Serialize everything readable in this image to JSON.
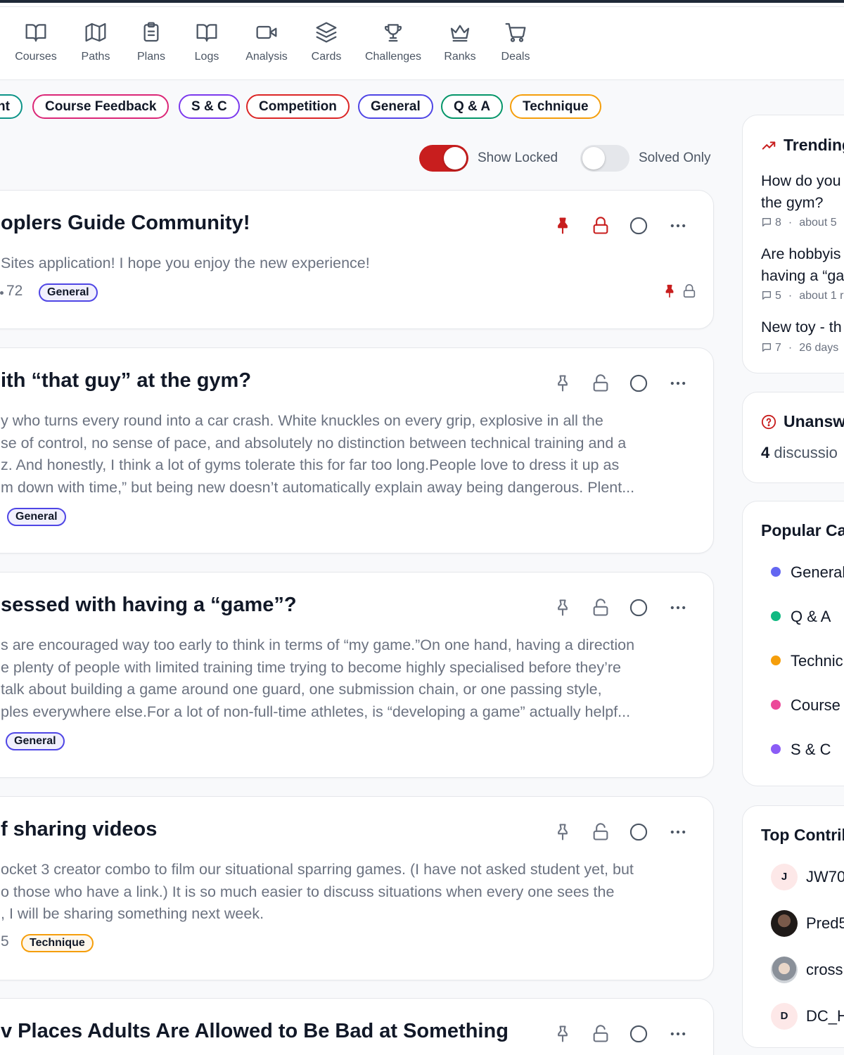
{
  "nav": {
    "items": [
      {
        "label": "Courses",
        "icon": "book-open-icon"
      },
      {
        "label": "Paths",
        "icon": "map-icon"
      },
      {
        "label": "Plans",
        "icon": "clipboard-icon"
      },
      {
        "label": "Logs",
        "icon": "book-icon"
      },
      {
        "label": "Analysis",
        "icon": "video-icon"
      },
      {
        "label": "Cards",
        "icon": "layers-icon"
      },
      {
        "label": "Challenges",
        "icon": "trophy-icon"
      },
      {
        "label": "Ranks",
        "icon": "crown-icon"
      },
      {
        "label": "Deals",
        "icon": "cart-icon"
      }
    ]
  },
  "chips": [
    {
      "label": "nt",
      "color": "#0d9488"
    },
    {
      "label": "Course Feedback",
      "color": "#db2777"
    },
    {
      "label": "S & C",
      "color": "#7c3aed"
    },
    {
      "label": "Competition",
      "color": "#dc2626"
    },
    {
      "label": "General",
      "color": "#4f46e5"
    },
    {
      "label": "Q & A",
      "color": "#059669"
    },
    {
      "label": "Technique",
      "color": "#f59e0b"
    }
  ],
  "filters": {
    "show_locked": {
      "label": "Show Locked",
      "on": true
    },
    "solved_only": {
      "label": "Solved Only",
      "on": false
    }
  },
  "colors": {
    "accent": "#c81e1e",
    "toggle_off": "#e5e7eb"
  },
  "posts": [
    {
      "title": "oplers Guide Community!",
      "body": [
        "Sites application! I hope you enjoy the new experience!"
      ],
      "meta": "72",
      "tag": "General",
      "tag_color": "#4f46e5",
      "pinned": true,
      "locked": true
    },
    {
      "title": "ith “that guy” at the gym?",
      "body": [
        "y who turns every round into a car crash. White knuckles on every grip, explosive in all the",
        "se of control, no sense of pace, and absolutely no distinction between technical training and a",
        "z. And honestly, I think a lot of gyms tolerate this for far too long.People love to dress it up as",
        "m down with time,” but being new doesn’t automatically explain away being dangerous. Plent..."
      ],
      "meta": "",
      "tag": "General",
      "tag_color": "#4f46e5",
      "pinned": false,
      "locked": false
    },
    {
      "title": "sessed with having a “game”?",
      "body": [
        "s are encouraged way too early to think in terms of “my game.”On one hand, having a direction",
        "e plenty of people with limited training time trying to become highly specialised before they’re",
        "talk about building a game around one guard, one submission chain, or one passing style,",
        "ples everywhere else.For a lot of non-full-time athletes, is “developing a game” actually helpf..."
      ],
      "meta": "",
      "tag": "General",
      "tag_color": "#4f46e5",
      "pinned": false,
      "locked": false
    },
    {
      "title": "f sharing videos",
      "body": [
        "ocket 3 creator combo to film our situational sparring games. (I have not asked student yet, but",
        "o those who have a link.) It is so much easier to discuss situations when every one sees the",
        ", I will be sharing something next week."
      ],
      "meta": "5",
      "tag": "Technique",
      "tag_color": "#f59e0b",
      "pinned": false,
      "locked": false
    },
    {
      "title": "v Places Adults Are Allowed to Be Bad at Something",
      "body": [],
      "meta": "",
      "tag": "",
      "tag_color": "#4f46e5",
      "pinned": false,
      "locked": false
    }
  ],
  "trending": {
    "title": "Trending",
    "items": [
      {
        "q1": "How do you",
        "q2": "the gym?",
        "comments": "8",
        "time": "about 5"
      },
      {
        "q1": "Are hobbyis",
        "q2": "having a “ga",
        "comments": "5",
        "time": "about 1 r"
      },
      {
        "q1": "New toy - th",
        "q2": "",
        "comments": "7",
        "time": "26 days"
      }
    ]
  },
  "unanswered": {
    "title": "Unansw",
    "count": "4",
    "text": "discussio"
  },
  "popular": {
    "title": "Popular Cat",
    "items": [
      {
        "label": "General",
        "color": "#6366f1"
      },
      {
        "label": "Q & A",
        "color": "#10b981"
      },
      {
        "label": "Technic",
        "color": "#f59e0b"
      },
      {
        "label": "Course",
        "color": "#ec4899"
      },
      {
        "label": "S & C",
        "color": "#8b5cf6"
      }
    ]
  },
  "contributors": {
    "title": "Top Contrib",
    "items": [
      {
        "initial": "J",
        "name": "JW70",
        "photo": false
      },
      {
        "initial": "",
        "name": "Pred5",
        "photo": true
      },
      {
        "initial": "",
        "name": "cross",
        "photo": true
      },
      {
        "initial": "D",
        "name": "DC_H",
        "photo": false
      }
    ]
  }
}
